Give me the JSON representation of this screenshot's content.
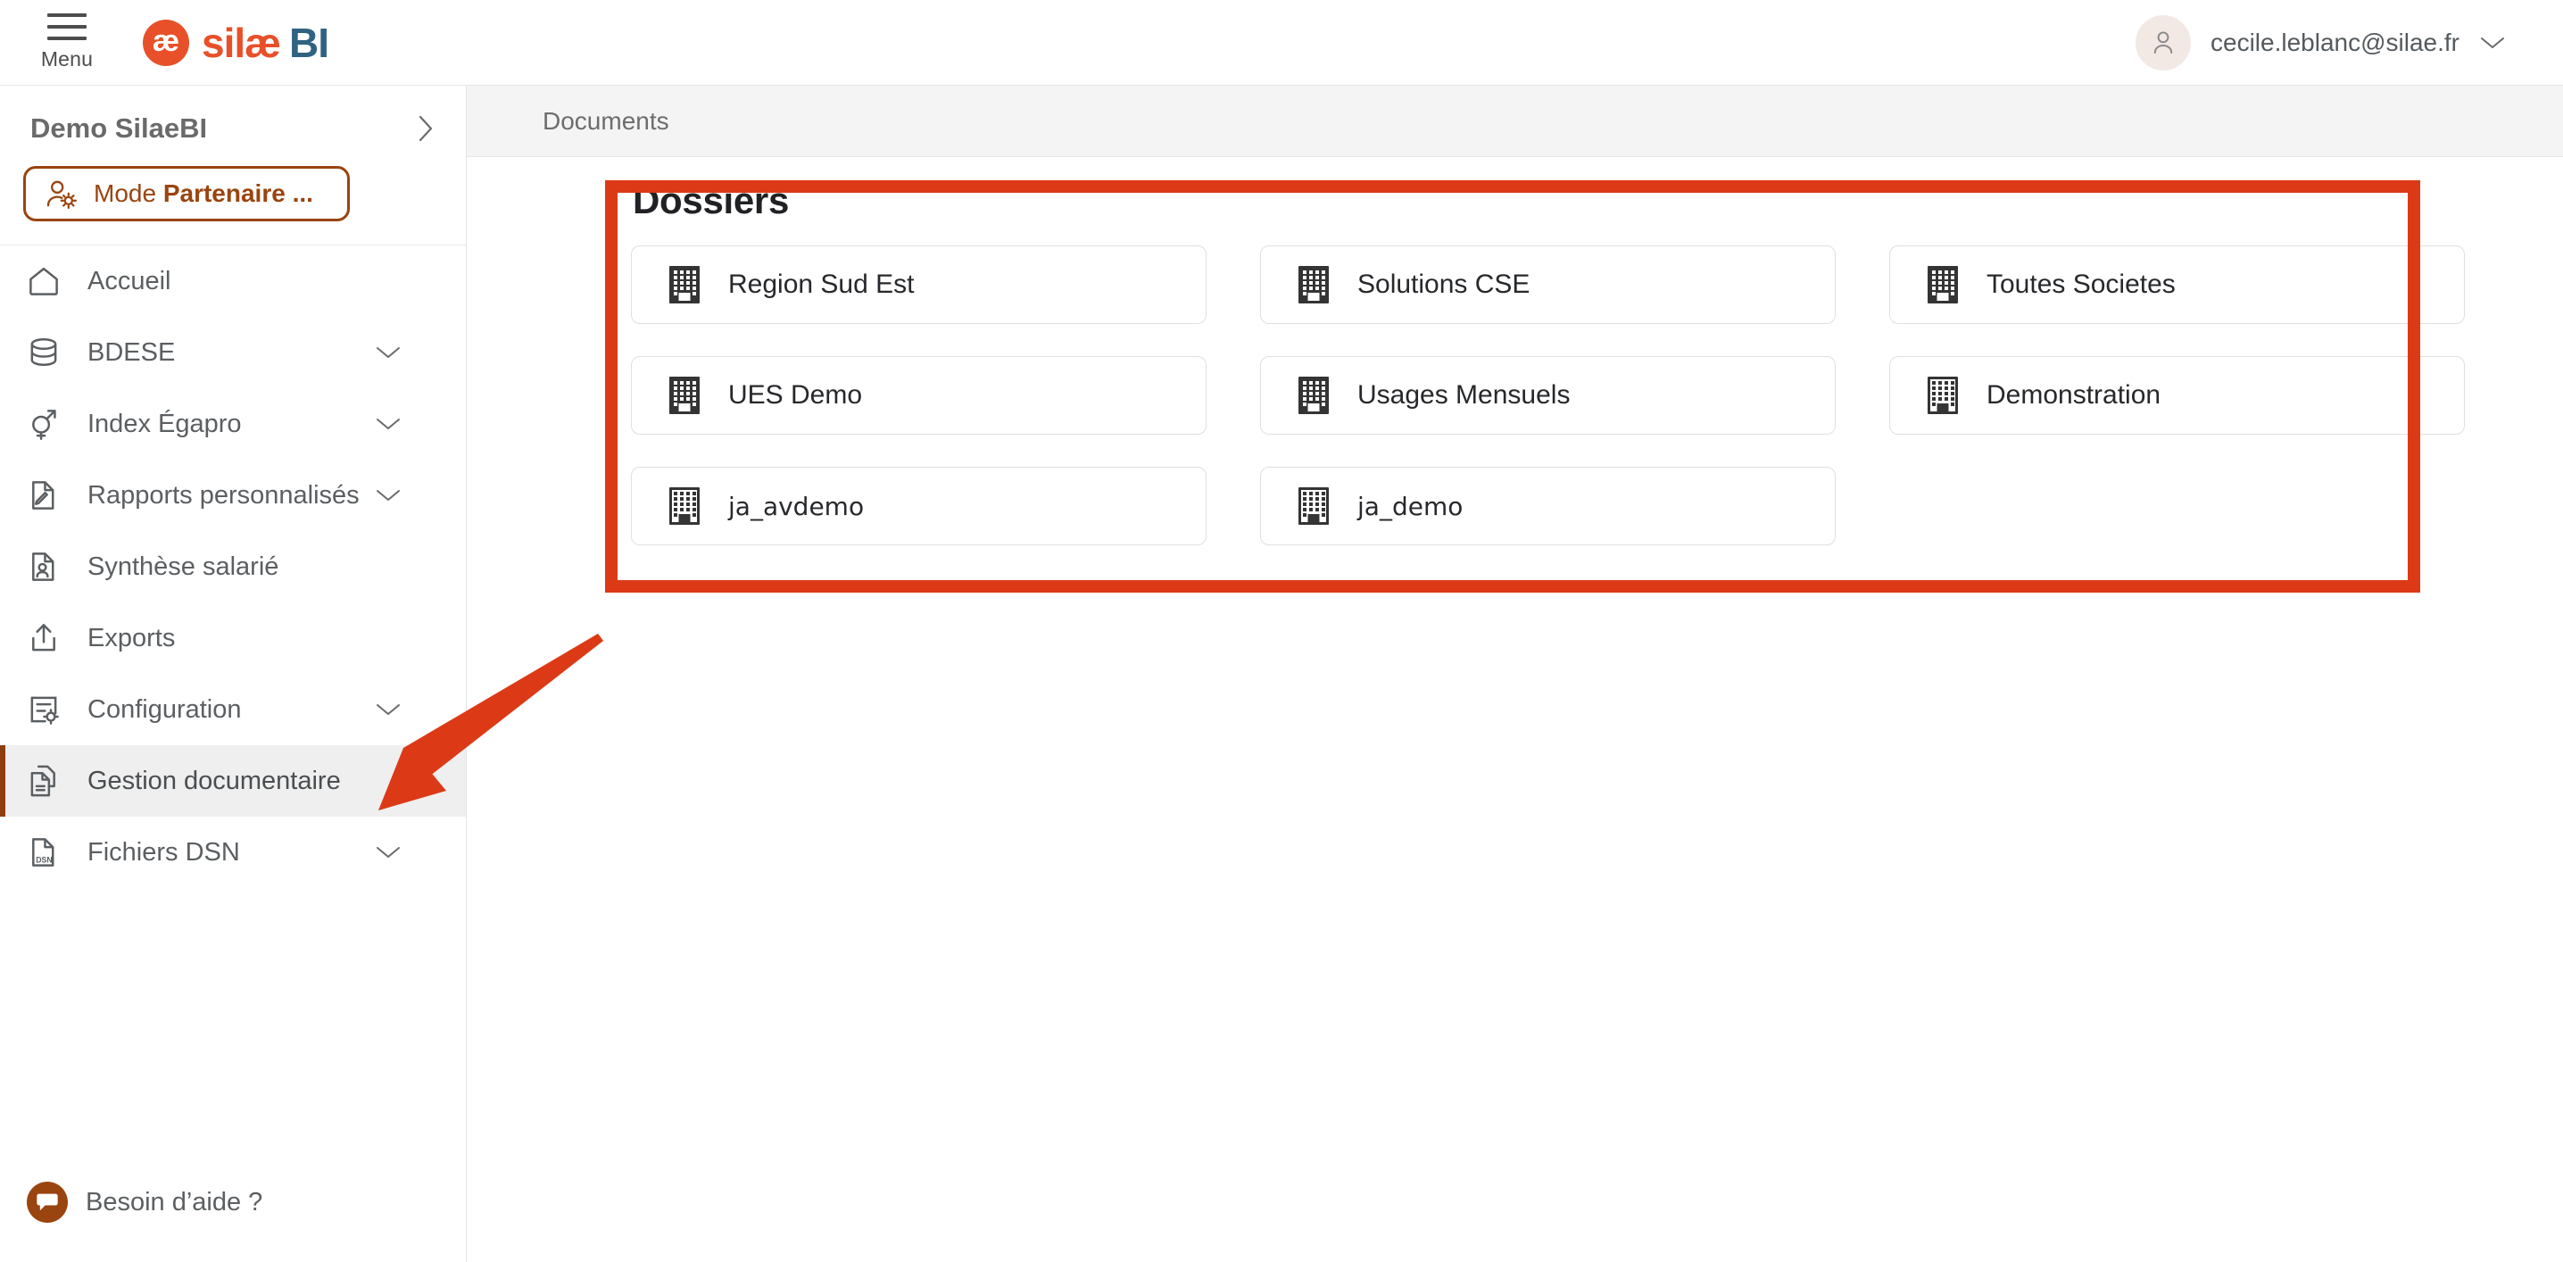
{
  "topbar": {
    "menu_label": "Menu",
    "menu_icon": "hamburger-icon",
    "brand_mark": "æ",
    "brand_name": "silæ",
    "brand_suffix": "BI",
    "user_email": "cecile.leblanc@silae.fr",
    "user_icon": "person-icon",
    "user_chevron": "chevron-down-icon"
  },
  "sidebar": {
    "workspace_name": "Demo SilaeBI",
    "workspace_chevron": "chevron-right-icon",
    "partner_button": {
      "prefix": "Mode ",
      "strong": "Partenaire ...",
      "icon": "user-gear-icon"
    },
    "items": [
      {
        "label": "Accueil",
        "icon": "home-icon",
        "chevron": false,
        "active": false
      },
      {
        "label": "BDESE",
        "icon": "database-icon",
        "chevron": true,
        "active": false
      },
      {
        "label": "Index Égapro",
        "icon": "gender-icon",
        "chevron": true,
        "active": false
      },
      {
        "label": "Rapports personnalisés",
        "icon": "document-pencil-icon",
        "chevron": true,
        "active": false
      },
      {
        "label": "Synthèse salarié",
        "icon": "document-person-icon",
        "chevron": false,
        "active": false
      },
      {
        "label": "Exports",
        "icon": "export-icon",
        "chevron": false,
        "active": false
      },
      {
        "label": "Configuration",
        "icon": "settings-list-icon",
        "chevron": true,
        "active": false
      },
      {
        "label": "Gestion documentaire",
        "icon": "documents-icon",
        "chevron": false,
        "active": true
      },
      {
        "label": "Fichiers DSN",
        "icon": "dsn-file-icon",
        "chevron": true,
        "active": false
      }
    ],
    "help": {
      "label": "Besoin d’aide ?",
      "icon": "chat-bubble-icon"
    }
  },
  "breadcrumb": {
    "items": [
      "Documents"
    ]
  },
  "main": {
    "panel_title": "Dossiers",
    "folders": [
      {
        "name": "Region Sud Est",
        "icon": "building-icon",
        "style": "solid",
        "font": "default"
      },
      {
        "name": "Solutions CSE",
        "icon": "building-icon",
        "style": "solid",
        "font": "default"
      },
      {
        "name": "Toutes Societes",
        "icon": "building-icon",
        "style": "solid",
        "font": "default"
      },
      {
        "name": "UES Demo",
        "icon": "building-icon",
        "style": "solid",
        "font": "default"
      },
      {
        "name": "Usages Mensuels",
        "icon": "building-icon",
        "style": "solid",
        "font": "default"
      },
      {
        "name": "Demonstration",
        "icon": "building-icon",
        "style": "outline",
        "font": "default"
      },
      {
        "name": "ja_avdemo",
        "icon": "building-icon",
        "style": "outline",
        "font": "alt"
      },
      {
        "name": "ja_demo",
        "icon": "building-icon",
        "style": "outline",
        "font": "alt"
      },
      {
        "name": "",
        "icon": "",
        "style": "none",
        "font": "default"
      }
    ]
  },
  "annotations": {
    "highlight_color": "#DC3A17",
    "arrow_color": "#DC3A17",
    "arrow_target": "sidebar-item-gestion-documentaire"
  },
  "colors": {
    "brand_orange": "#E8502A",
    "brand_blue": "#2F6382",
    "partner_brown": "#9A4410",
    "active_bar": "#8F3D0B",
    "annotation_red": "#DC3A17"
  }
}
